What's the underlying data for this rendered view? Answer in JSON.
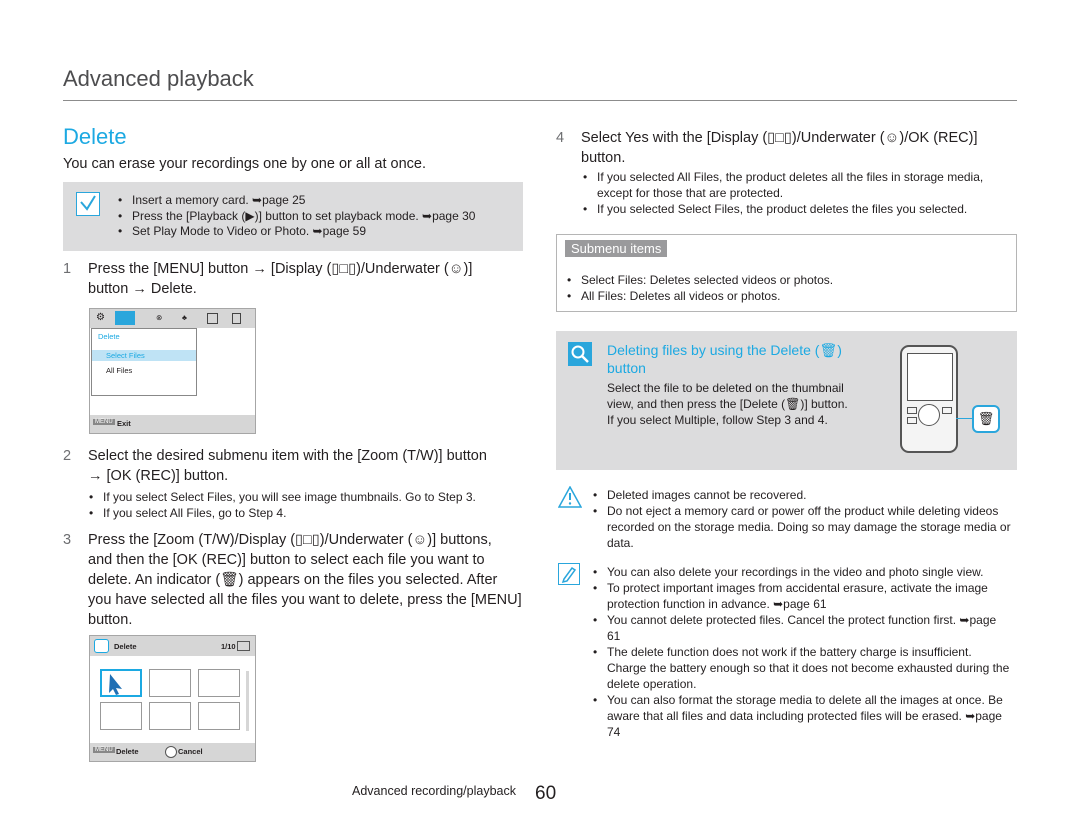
{
  "header": {
    "section_title": "Advanced playback"
  },
  "left": {
    "heading": "Delete",
    "intro": "You can erase your recordings one by one or all at once.",
    "prereq": [
      "Insert a memory card. ➥page 25",
      "Press the [Playback (▶)] button to set playback mode. ➥page 30",
      "Set Play Mode to Video or Photo. ➥page 59"
    ],
    "step1": {
      "num": "1",
      "line1": "Press the [MENU] button → [Display (▯□▯)/Underwater (☺)]",
      "line2": "button → Delete."
    },
    "screen1": {
      "menu_title": "Delete",
      "item1": "Select Files",
      "item2": "All Files",
      "exit_key": "MENU",
      "exit": "Exit"
    },
    "step2": {
      "num": "2",
      "line1": "Select the desired submenu item with the [Zoom (T/W)] button",
      "line2": "→ [OK (REC)] button."
    },
    "step2_bullets": [
      "If you select Select Files, you will see image thumbnails. Go to Step 3.",
      "If you select All Files, go to Step 4."
    ],
    "step3": {
      "num": "3",
      "lines": [
        "Press the [Zoom (T/W)/Display (▯□▯)/Underwater (☺)] buttons,",
        "and then the [OK (REC)] button to select each file you want to",
        "delete. An indicator (🗑) appears on the files you selected. After",
        "you have selected all the files you want to delete, press the [MENU]",
        "button."
      ]
    },
    "screen2": {
      "title": "Delete",
      "counter": "1/10",
      "key_menu": "MENU",
      "btn_delete": "Delete",
      "btn_cancel": "Cancel"
    }
  },
  "right": {
    "step4": {
      "num": "4",
      "line1": "Select Yes with the [Display (▯□▯)/Underwater (☺)/OK (REC)]",
      "line2": "button."
    },
    "step4_bullets": [
      "If you selected All Files, the product deletes all the files in storage media, except for those that are protected.",
      "If you selected Select Files, the product deletes the files you selected."
    ],
    "submenu": {
      "title": "Submenu items",
      "items": [
        "Select Files: Deletes selected videos or photos.",
        "All Files: Deletes all videos or photos."
      ]
    },
    "tip": {
      "title_line1": "Deleting files by using the Delete (🗑)",
      "title_line2": "button",
      "lines": [
        "Select the file to be deleted on the thumbnail",
        "view, and then press the [Delete (🗑)] button.",
        "If you select Multiple, follow Step 3 and 4."
      ]
    },
    "warnings": [
      "Deleted images cannot be recovered.",
      "Do not eject a memory card or power off the product while deleting videos recorded on the storage media. Doing so may damage the storage media or data."
    ],
    "notes": [
      "You can also delete your recordings in the video and photo single view.",
      "To protect important images from accidental erasure, activate the image protection function in advance. ➥page 61",
      "You cannot delete protected files. Cancel the protect function first. ➥page 61",
      "The delete function does not work if the battery charge is insufficient. Charge the battery enough so that it does not become exhausted during the delete operation.",
      "You can also format the storage media to delete all the images at once. Be aware that all files and data including protected files will be erased. ➥page 74"
    ]
  },
  "footer": {
    "label": "Advanced recording/playback",
    "page": "60"
  },
  "colors": {
    "accent": "#1ca9e2",
    "panel": "#dcdcdd",
    "warning": "#2aa6dc"
  }
}
